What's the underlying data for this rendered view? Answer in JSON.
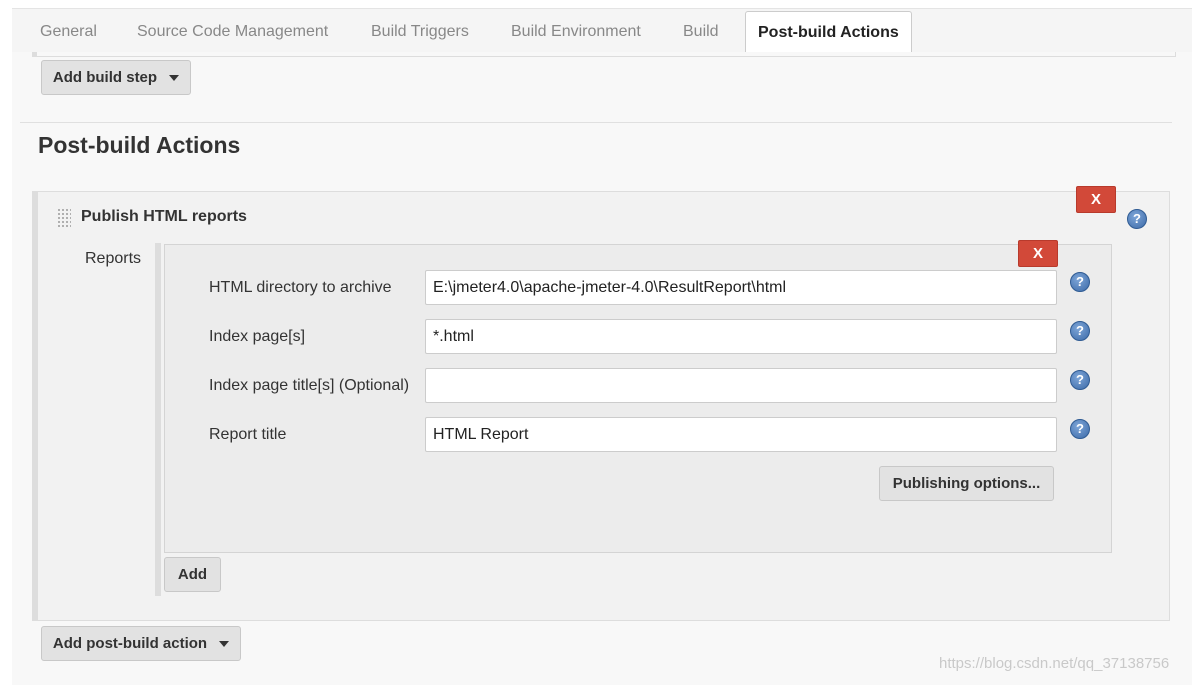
{
  "tabs": [
    {
      "label": "General"
    },
    {
      "label": "Source Code Management"
    },
    {
      "label": "Build Triggers"
    },
    {
      "label": "Build Environment"
    },
    {
      "label": "Build"
    },
    {
      "label": "Post-build Actions"
    }
  ],
  "build": {
    "add_build_step_label": "Add build step"
  },
  "post_build": {
    "section_title": "Post-build Actions",
    "publish_title": "Publish HTML reports",
    "delete_label": "X",
    "help_label": "?",
    "reports_label": "Reports",
    "fields": [
      {
        "label": "HTML directory to archive",
        "value": "E:\\jmeter4.0\\apache-jmeter-4.0\\ResultReport\\html"
      },
      {
        "label": "Index page[s]",
        "value": "*.html"
      },
      {
        "label": "Index page title[s] (Optional)",
        "value": ""
      },
      {
        "label": "Report title",
        "value": "HTML Report"
      }
    ],
    "publishing_options_label": "Publishing options...",
    "add_label": "Add",
    "add_post_build_action_label": "Add post-build action"
  },
  "watermark": "https://blog.csdn.net/qq_37138756",
  "colors": {
    "delete_button": "#d24939",
    "help_icon": "#3c6aa8"
  }
}
